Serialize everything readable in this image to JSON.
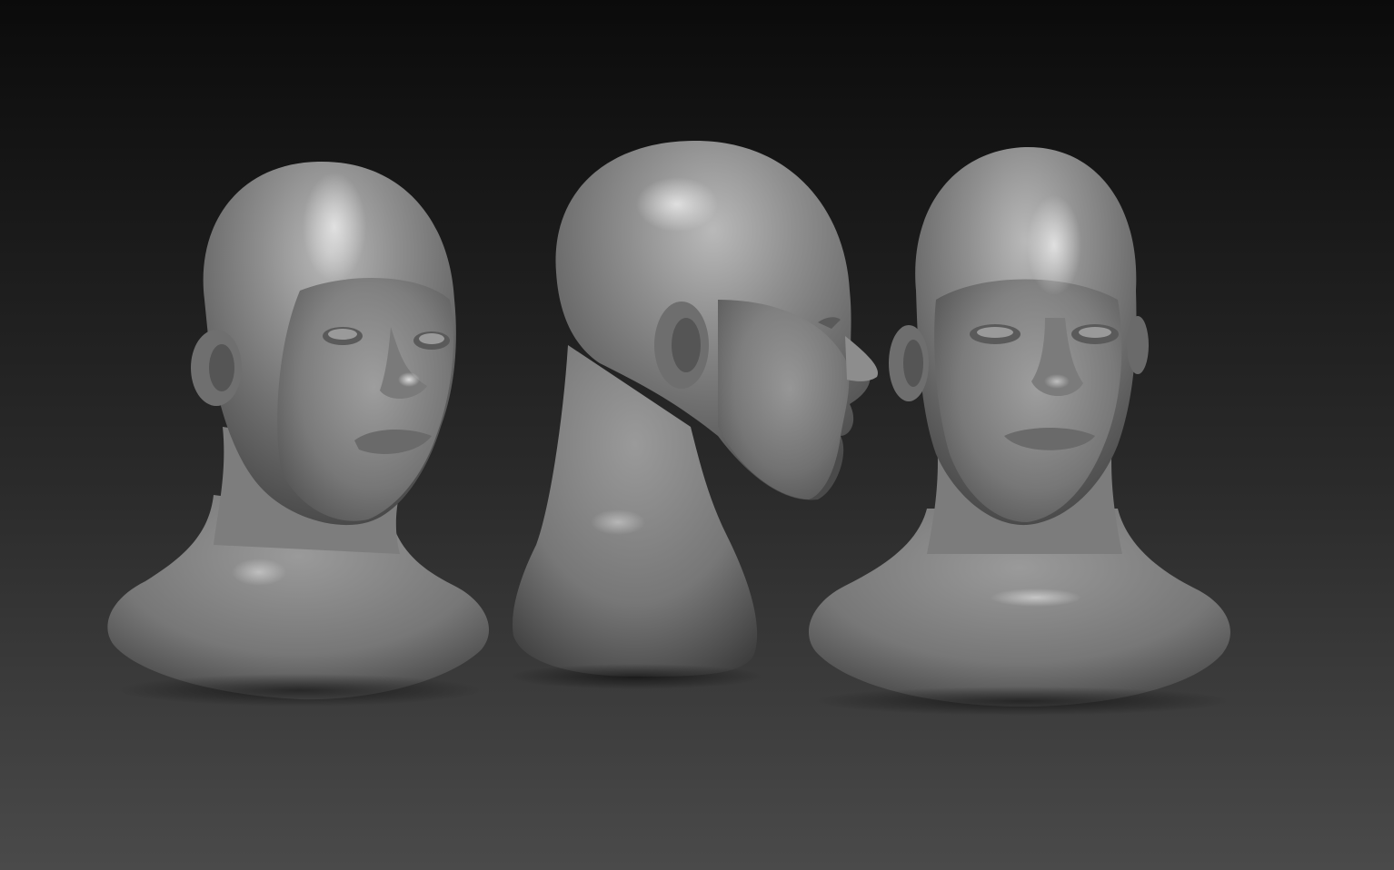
{
  "scene": {
    "description_visible_text": "",
    "background": {
      "top_color": "#0b0b0b",
      "bottom_color": "#4a4a4a"
    },
    "material_color": "#8a8a8a",
    "models": [
      {
        "view": "three-quarter"
      },
      {
        "view": "side-profile"
      },
      {
        "view": "front"
      }
    ]
  }
}
